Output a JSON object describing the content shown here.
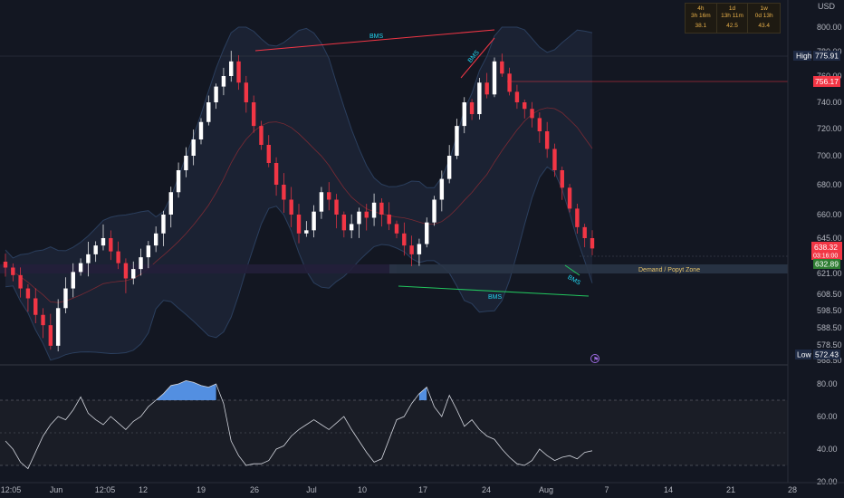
{
  "chart_data": {
    "type": "candlestick",
    "currency_label": "USD",
    "price_axis_ticks": [
      800.0,
      780.0,
      760.0,
      740.0,
      720.0,
      700.0,
      680.0,
      660.0,
      645.0,
      621.0,
      608.5,
      598.5,
      588.5,
      578.5,
      568.5
    ],
    "price_axis_tick_labels": [
      "800.00",
      "780.00",
      "760.00",
      "740.00",
      "720.00",
      "700.00",
      "680.00",
      "660.00",
      "645.00",
      "621.00",
      "608.50",
      "598.50",
      "588.50",
      "578.50",
      "568.50"
    ],
    "rsi_axis_ticks": [
      80.0,
      60.0,
      40.0,
      20.0
    ],
    "rsi_axis_tick_labels": [
      "80.00",
      "60.00",
      "40.00",
      "20.00"
    ],
    "time_axis_labels": [
      "12:05",
      "Jun",
      "12:05",
      "12",
      "19",
      "26",
      "Jul",
      "10",
      "17",
      "24",
      "Aug",
      "7",
      "14",
      "21",
      "28"
    ],
    "price_series": [
      625,
      620,
      612,
      606,
      596,
      590,
      578,
      600,
      612,
      622,
      628,
      634,
      640,
      645,
      636,
      628,
      618,
      624,
      632,
      640,
      648,
      660,
      675,
      690,
      700,
      712,
      725,
      740,
      752,
      760,
      772,
      755,
      740,
      722,
      708,
      695,
      680,
      670,
      660,
      648,
      650,
      662,
      675,
      670,
      660,
      650,
      654,
      662,
      658,
      668,
      660,
      654,
      648,
      640,
      634,
      641,
      655,
      670,
      684,
      700,
      722,
      740,
      731,
      755,
      746,
      772,
      762,
      748,
      740,
      735,
      728,
      718,
      705,
      690,
      678,
      664,
      652,
      645,
      638
    ],
    "price_labels": {
      "high": {
        "label": "High",
        "value": "775.91"
      },
      "red_level": "756.17",
      "current": "638.32",
      "countdown": "03:16:00",
      "green_level": "632.89",
      "low": {
        "label": "Low",
        "value": "572.43"
      }
    },
    "annotations": {
      "bos_label": "BMS",
      "zone_label": "Demand / Popyt Zone"
    },
    "rsi_levels": [
      70,
      50,
      30
    ],
    "rsi_series": [
      45,
      40,
      32,
      28,
      38,
      48,
      55,
      60,
      58,
      64,
      72,
      62,
      58,
      55,
      60,
      56,
      52,
      57,
      60,
      66,
      70,
      74,
      79,
      80,
      82,
      81,
      79,
      78,
      80,
      68,
      45,
      36,
      30,
      31,
      31,
      33,
      40,
      42,
      48,
      52,
      55,
      58,
      55,
      52,
      56,
      60,
      52,
      45,
      38,
      32,
      34,
      46,
      58,
      60,
      68,
      74,
      78,
      66,
      60,
      73,
      64,
      54,
      58,
      52,
      48,
      46,
      40,
      35,
      31,
      30,
      33,
      40,
      36,
      33,
      35,
      36,
      34,
      38,
      39
    ]
  },
  "mtf_table": [
    {
      "tf": "4h",
      "remaining": "3h 16m",
      "rsi": "38.1"
    },
    {
      "tf": "1d",
      "remaining": "13h 11m",
      "rsi": "42.5"
    },
    {
      "tf": "1w",
      "remaining": "0d 13h",
      "rsi": "43.4"
    }
  ],
  "colors": {
    "background": "#131722",
    "up": "#ffffff",
    "down": "#f23645",
    "band_fill": "#1c2436",
    "band_line": "#2d4a6e",
    "bos_line": "#f23645",
    "bos_bull_line": "#22c55e",
    "bos_text": "#22d3ee",
    "zone": "#2a2e39",
    "rsi_line": "#d1d4dc",
    "rsi_fill": "#5b9cf6"
  }
}
